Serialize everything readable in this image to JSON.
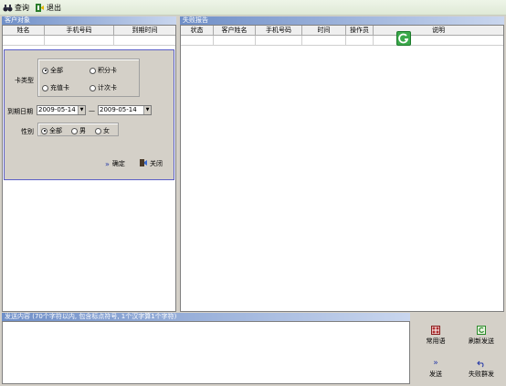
{
  "toolbar": {
    "query_label": "查询",
    "exit_label": "退出"
  },
  "left": {
    "section_title": "客户对象",
    "columns": [
      "姓名",
      "手机号码",
      "到期时间"
    ]
  },
  "filter": {
    "card_type_label": "卡类型",
    "card_types": [
      "全部",
      "积分卡",
      "充值卡",
      "计次卡"
    ],
    "card_type_selected": "全部",
    "expire_label": "到期日期",
    "date_from": "2009-05-14",
    "date_sep": "—",
    "date_to": "2009-05-14",
    "gender_label": "性别",
    "genders": [
      "全部",
      "男",
      "女"
    ],
    "gender_selected": "全部",
    "confirm_label": "确定",
    "close_label": "关闭"
  },
  "right": {
    "section_title": "失败报告",
    "columns": [
      "状态",
      "客户姓名",
      "手机号码",
      "时间",
      "操作员",
      "说明"
    ]
  },
  "bottom": {
    "send_content_label": "发送内容 (70个字符以内, 包含标点符号, 1个汉字算1个字符)",
    "common_label": "常用语",
    "resend_label": "刷新发送",
    "send_label": "发送",
    "fail_resend_label": "失败群发"
  },
  "colors": {
    "accent_border": "#5b5fc8",
    "section_header": "#6f8fc8",
    "green_badge": "#3aa84a"
  },
  "icons": [
    "binoculars-icon",
    "exit-icon",
    "refresh-badge-icon",
    "double-chevron-icon",
    "door-exit-icon",
    "grid-book-icon",
    "refresh-send-icon",
    "send-chevron-icon",
    "undo-send-icon"
  ]
}
